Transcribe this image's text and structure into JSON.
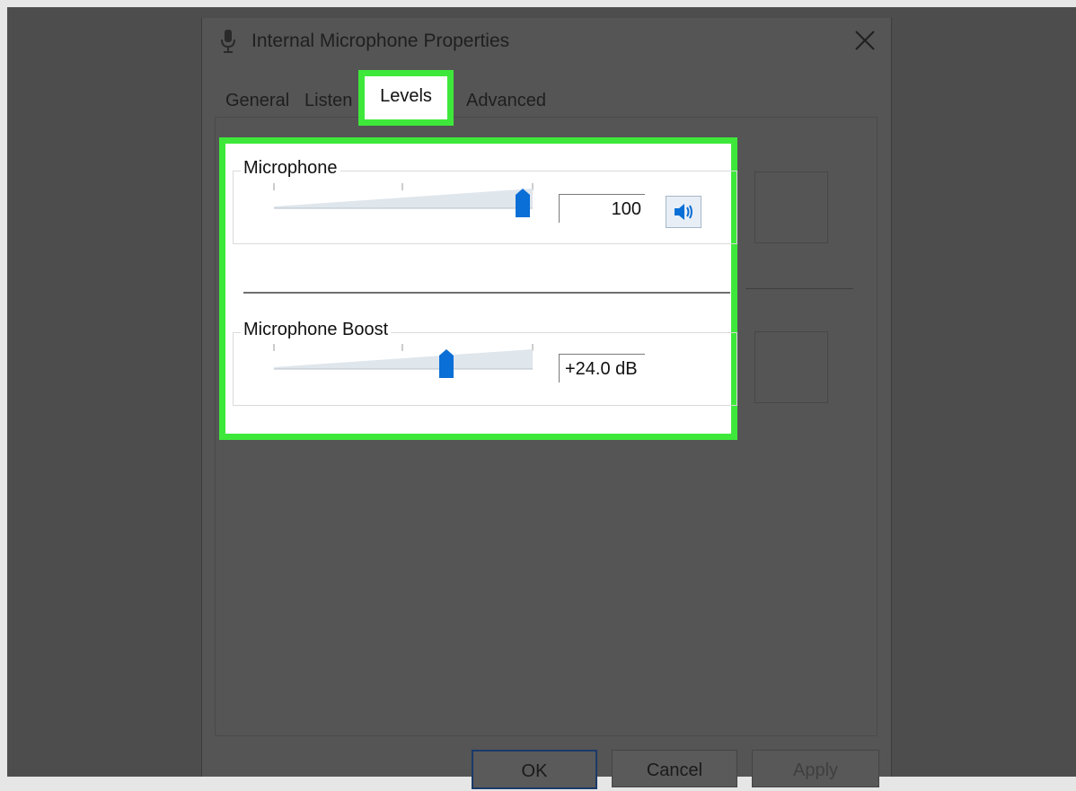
{
  "window": {
    "title": "Internal Microphone Properties",
    "title_icon": "microphone-icon",
    "close_icon": "close-icon"
  },
  "tabs": [
    {
      "label": "General",
      "selected": false
    },
    {
      "label": "Listen",
      "selected": false
    },
    {
      "label": "Levels",
      "selected": true
    },
    {
      "label": "Advanced",
      "selected": false
    }
  ],
  "levels": {
    "microphone": {
      "label": "Microphone",
      "value": "100",
      "slider_level_percent": 100,
      "mute_icon": "speaker-icon"
    },
    "boost": {
      "label": "Microphone Boost",
      "value": "+24.0 dB",
      "slider_level_percent": 67
    }
  },
  "buttons": {
    "ok": "OK",
    "cancel": "Cancel",
    "apply": "Apply"
  },
  "colors": {
    "highlight": "#3ee83a",
    "slider_thumb": "#0a6fd6",
    "dim_overlay": "#555555"
  }
}
